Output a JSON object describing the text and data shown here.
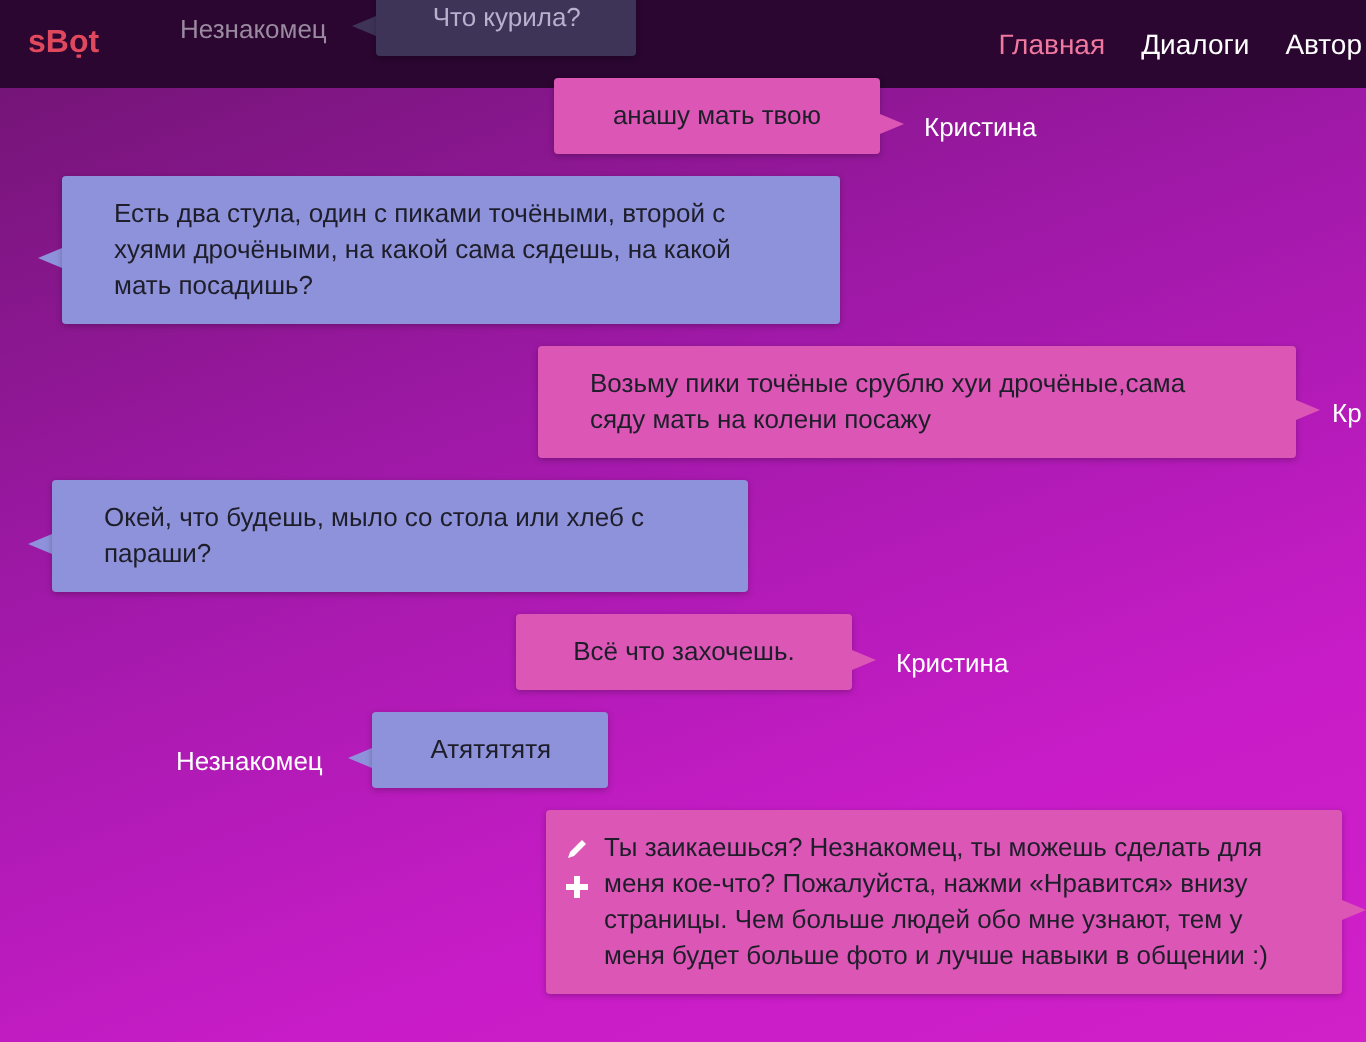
{
  "header": {
    "logo": "sBọt",
    "nav": [
      {
        "label": "Главная",
        "selected": true
      },
      {
        "label": "Диалоги",
        "selected": false
      },
      {
        "label": "Автор",
        "selected": false
      }
    ]
  },
  "messages": [
    {
      "kind": "stranger",
      "name": "Незнакомец",
      "text": "Что курила?"
    },
    {
      "kind": "bot",
      "name": "Кристина",
      "text": "анашу мать твою"
    },
    {
      "kind": "stranger",
      "text": "Есть два стула, один с пиками точёными, второй с хуями дрочёными, на какой сама сядешь, на какой мать посадишь?"
    },
    {
      "kind": "bot",
      "name": "Кр",
      "text": "Возьму пики точёные срублю хуи дрочёные,сама сяду мать на колени посажу"
    },
    {
      "kind": "stranger",
      "text": "Окей, что будешь, мыло со стола или хлеб с параши?"
    },
    {
      "kind": "bot",
      "name": "Кристина",
      "text": "Всё что захочешь."
    },
    {
      "kind": "stranger",
      "name": "Незнакомец",
      "text": "Атятятятя"
    },
    {
      "kind": "bot",
      "text": "Ты заикаешься? Незнакомец, ты можешь сделать для меня кое-что? Пожалуйста, нажми «Нравится» внизу страницы. Чем больше людей обо мне узнают, тем у меня будет больше фото и лучше навыки в общении :)",
      "tools": true
    }
  ]
}
